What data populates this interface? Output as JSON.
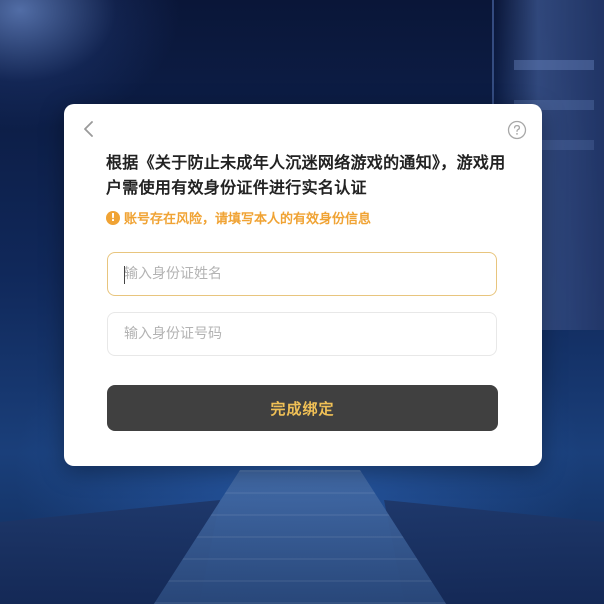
{
  "dialog": {
    "title": "根据《关于防止未成年人沉迷网络游戏的通知》，游戏用户需使用有效身份证件进行实名认证",
    "warning": "账号存在风险，请填写本人的有效身份信息",
    "warning_icon": "exclamation-icon",
    "back_icon": "chevron-left-icon",
    "help_icon": "question-circle-icon"
  },
  "form": {
    "name_placeholder": "输入身份证姓名",
    "id_placeholder": "输入身份证号码",
    "submit_label": "完成绑定"
  },
  "colors": {
    "accent": "#f0a334",
    "button_bg": "#404040",
    "button_text": "#f0c056",
    "active_border": "#e8c57e"
  }
}
